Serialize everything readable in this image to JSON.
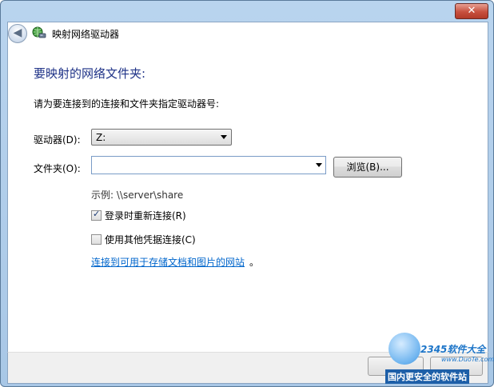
{
  "window": {
    "title": "映射网络驱动器",
    "close_label": "✕"
  },
  "content": {
    "heading": "要映射的网络文件夹:",
    "instruction": "请为要连接到的连接和文件夹指定驱动器号:",
    "drive": {
      "label": "驱动器(D):",
      "value": "Z:"
    },
    "folder": {
      "label": "文件夹(O):",
      "value": "",
      "browse_label": "浏览(B)..."
    },
    "example": "示例: \\\\server\\share",
    "reconnect": {
      "label": "登录时重新连接(R)",
      "checked": true
    },
    "other_credentials": {
      "label": "使用其他凭据连接(C)",
      "checked": false
    },
    "link": {
      "text": "连接到可用于存储文档和图片的网站",
      "suffix": "。"
    }
  },
  "watermark": {
    "brand": "2345软件大全",
    "url": "www.DuoTe.com",
    "slogan": "国内更安全的软件站"
  },
  "icons": {
    "back": "back-arrow-icon",
    "title": "network-drive-icon",
    "dropdown": "chevron-down-icon",
    "checkmark": "checkmark-icon"
  }
}
